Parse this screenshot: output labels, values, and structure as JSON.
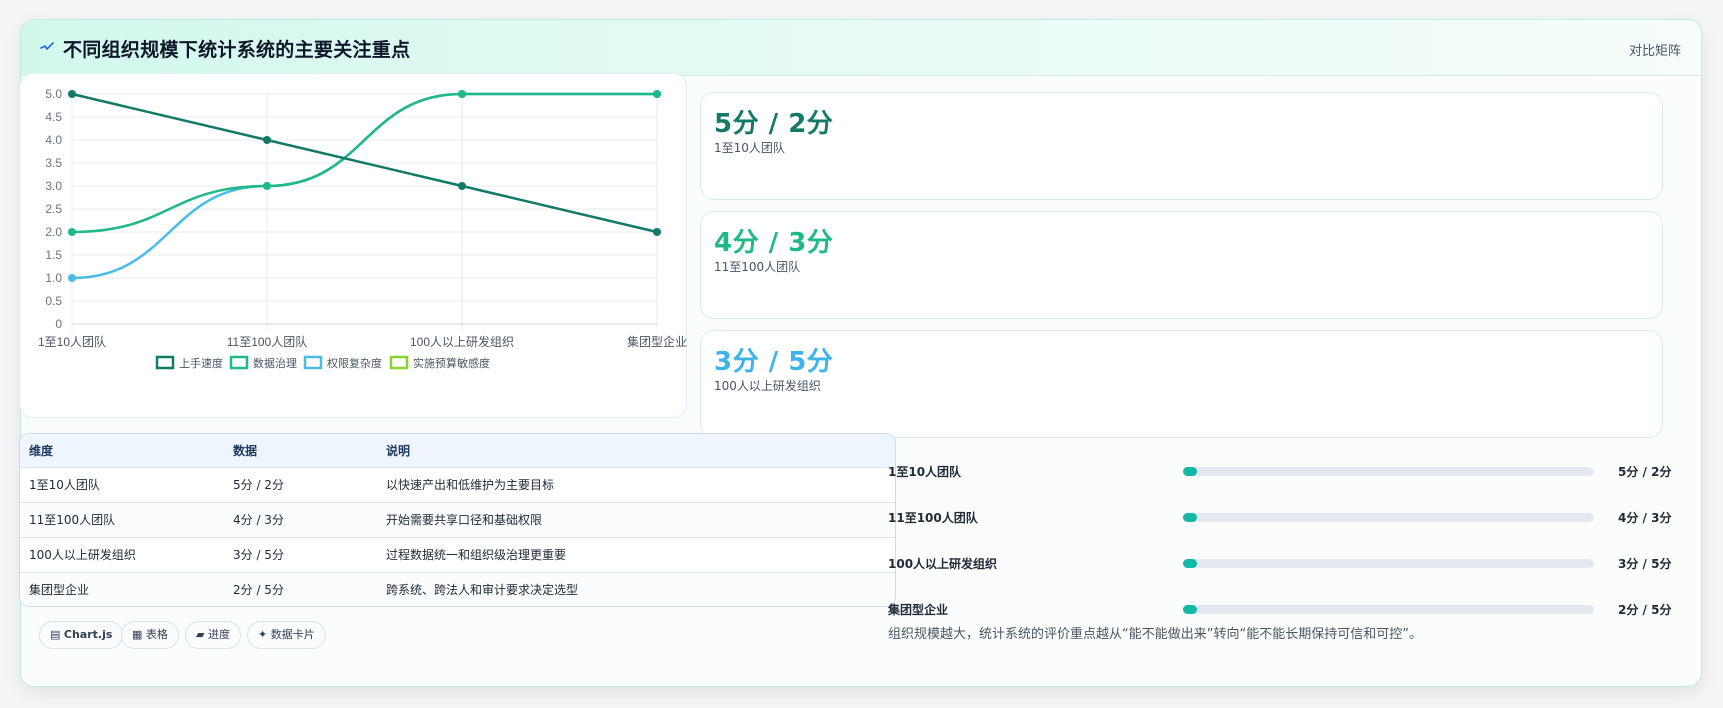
{
  "header": {
    "title": "不同组织规模下统计系统的主要关注重点",
    "tag": "对比矩阵",
    "icon": "pulse-icon"
  },
  "chart_data": {
    "type": "line",
    "categories": [
      "1至10人团队",
      "11至100人团队",
      "100人以上研发组织",
      "集团型企业"
    ],
    "series": [
      {
        "name": "上手速度",
        "values": [
          5,
          4,
          3,
          2
        ],
        "color": "#137a66"
      },
      {
        "name": "数据治理",
        "values": [
          2,
          3,
          5,
          5
        ],
        "color": "#1fb887"
      },
      {
        "name": "权限复杂度",
        "values": [
          1,
          3,
          5,
          5
        ],
        "color": "#49bde6"
      },
      {
        "name": "实施预算敏感度",
        "values": [],
        "color": "#8fd130"
      }
    ],
    "ylim": [
      0,
      5
    ],
    "yticks": [
      "5.0",
      "4.5",
      "4.0",
      "3.5",
      "3.0",
      "2.5",
      "2.0",
      "1.5",
      "1.0",
      "0.5",
      "0"
    ],
    "grid": true,
    "legend": "bottom"
  },
  "stats": [
    {
      "value": "5分 / 2分",
      "label": "1至10人团队",
      "color": "#137a66"
    },
    {
      "value": "4分 / 3分",
      "label": "11至100人团队",
      "color": "#1fb887"
    },
    {
      "value": "3分 / 5分",
      "label": "100人以上研发组织",
      "color": "#3cb4e7"
    }
  ],
  "table": {
    "headers": [
      "维度",
      "数据",
      "说明"
    ],
    "rows": [
      [
        "1至10人团队",
        "5分 / 2分",
        "以快速产出和低维护为主要目标"
      ],
      [
        "11至100人团队",
        "4分 / 3分",
        "开始需要共享口径和基础权限"
      ],
      [
        "100人以上研发组织",
        "3分 / 5分",
        "过程数据统一和组织级治理更重要"
      ],
      [
        "集团型企业",
        "2分 / 5分",
        "跨系统、跨法人和审计要求决定选型"
      ]
    ]
  },
  "chips": [
    "Chart.js",
    "表格",
    "进度",
    "数据卡片"
  ],
  "chip_icons": [
    "chart-icon",
    "table-icon",
    "progress-icon",
    "sparkle-icon"
  ],
  "progress": [
    {
      "label": "1至10人团队",
      "value": "5分 / 2分",
      "fill": 0.035
    },
    {
      "label": "11至100人团队",
      "value": "4分 / 3分",
      "fill": 0.035
    },
    {
      "label": "100人以上研发组织",
      "value": "3分 / 5分",
      "fill": 0.035
    },
    {
      "label": "集团型企业",
      "value": "2分 / 5分",
      "fill": 0.035
    }
  ],
  "footnote": "组织规模越大，统计系统的评价重点越从“能不能做出来”转向“能不能长期保持可信和可控”。"
}
